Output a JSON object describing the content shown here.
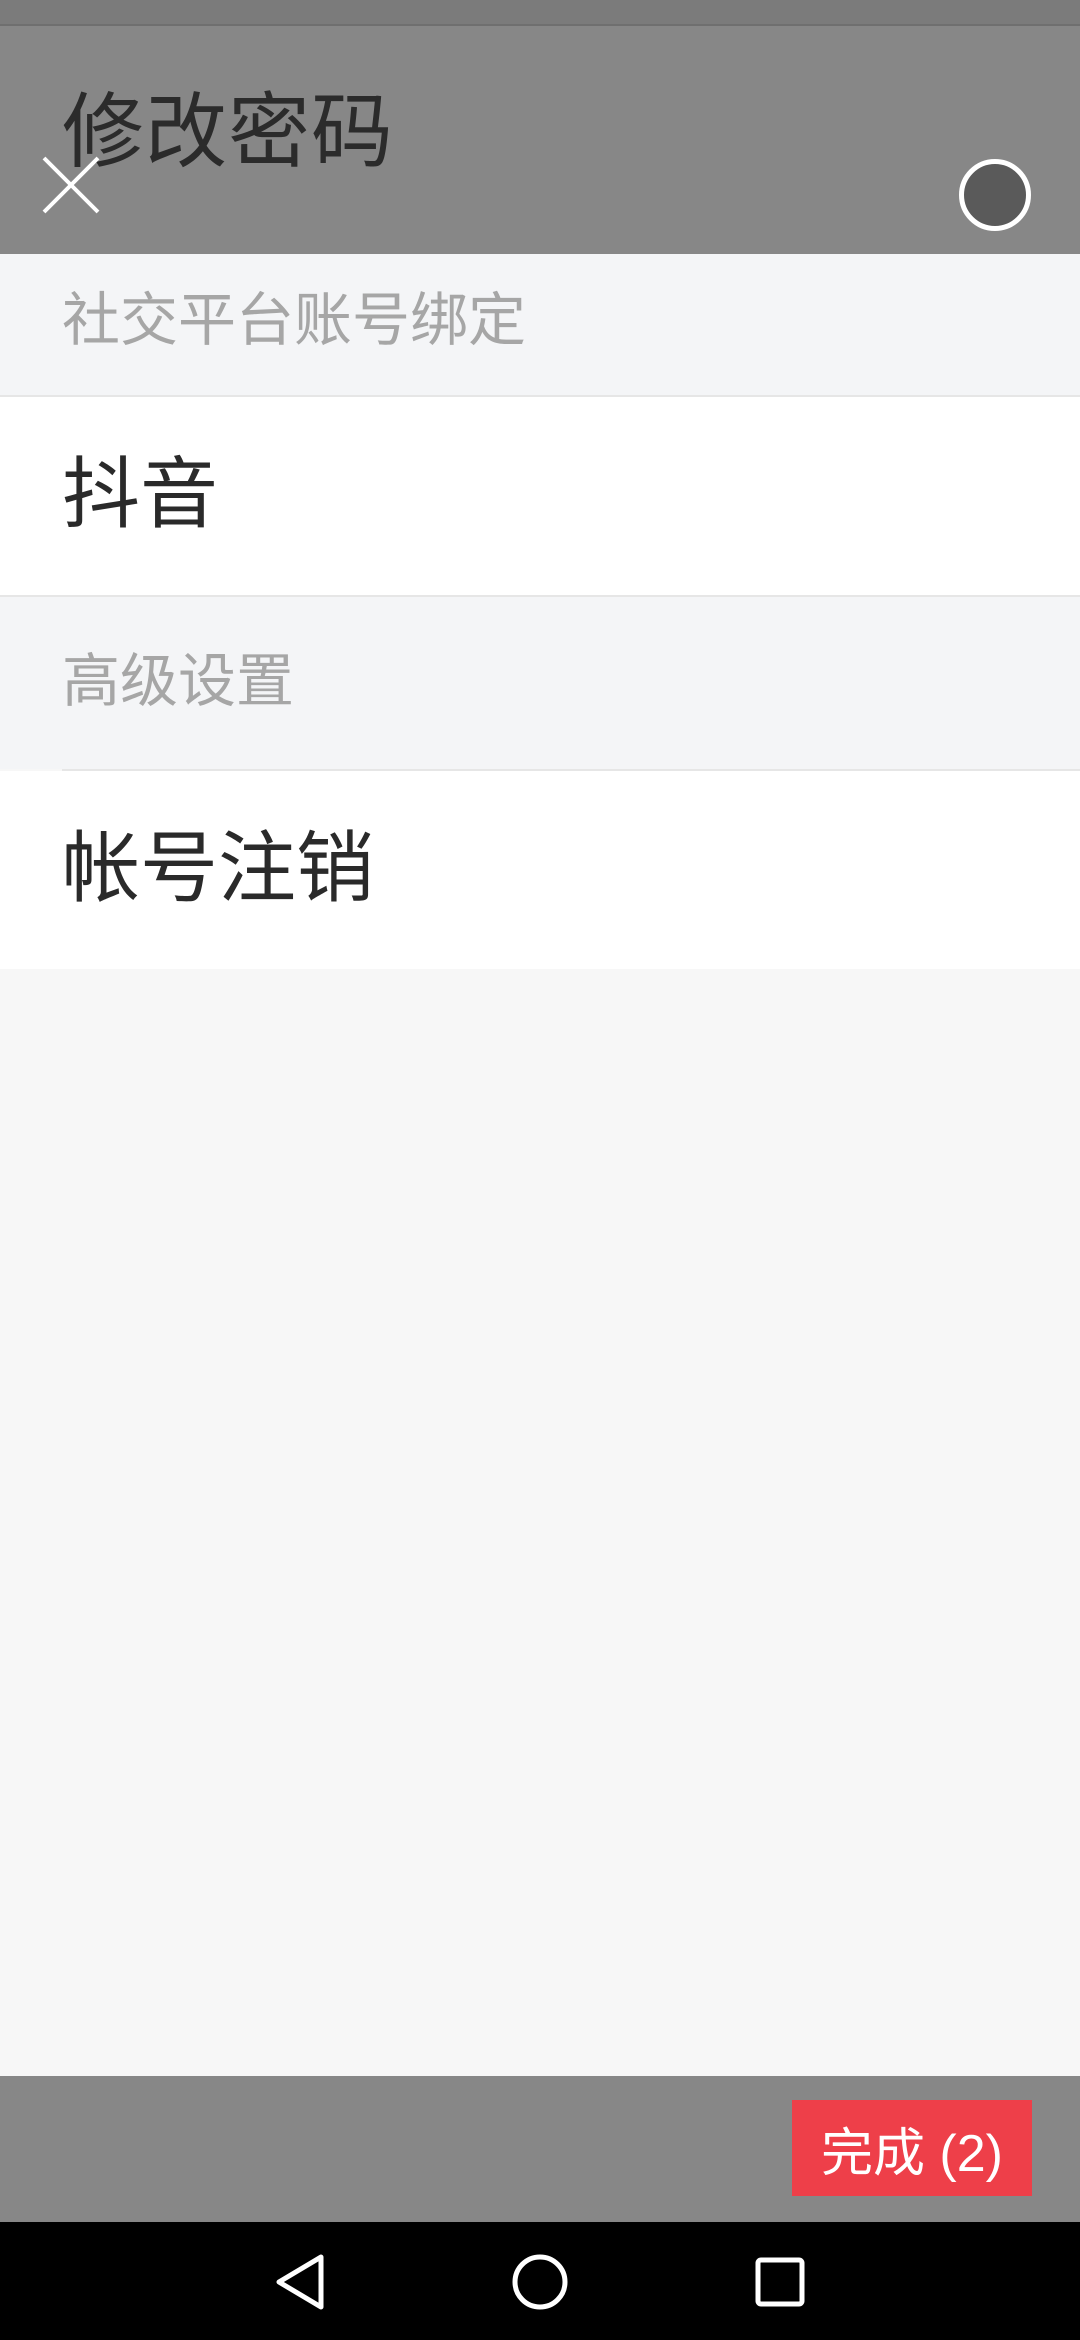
{
  "header": {
    "title": "修改密码"
  },
  "sections": {
    "social": {
      "header": "社交平台账号绑定",
      "items": [
        "抖音"
      ]
    },
    "advanced": {
      "header": "高级设置",
      "items": [
        "帐号注销"
      ]
    }
  },
  "footer": {
    "done_label": "完成 (2)"
  },
  "colors": {
    "overlay": "#878787",
    "accent": "#ee3f49",
    "section_bg": "#f4f5f7",
    "text_primary": "#2a2a2a",
    "text_secondary": "#a6a6a6"
  },
  "icons": {
    "close": "close-icon",
    "circle": "circle-button",
    "nav_back": "back-triangle-icon",
    "nav_home": "home-circle-icon",
    "nav_recents": "recents-square-icon"
  }
}
